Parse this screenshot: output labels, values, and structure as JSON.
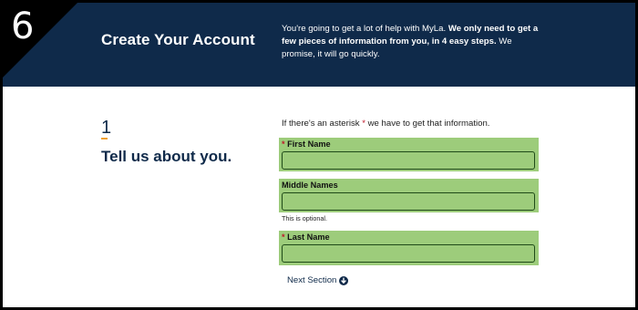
{
  "step_badge": "6",
  "header": {
    "title": "Create Your Account",
    "desc_part1": "You're going to get a lot of help with MyLa. ",
    "desc_bold": "We only need to get a few pieces of information from you, in 4 easy steps.",
    "desc_part2": " We promise, it will go quickly."
  },
  "section": {
    "number": "1",
    "title": "Tell us about you."
  },
  "note": {
    "before": "If there's an asterisk ",
    "asterisk": "*",
    "after": " we have to get that information."
  },
  "fields": {
    "first_name": {
      "required_mark": "*",
      "label": "First Name",
      "value": ""
    },
    "middle_names": {
      "label": "Middle Names",
      "value": "",
      "hint": "This is optional."
    },
    "last_name": {
      "required_mark": "*",
      "label": "Last Name",
      "value": ""
    }
  },
  "next_section": {
    "label": "Next Section",
    "icon": "arrow-down-circle-icon"
  },
  "colors": {
    "header_bg": "#0f2a4a",
    "highlight": "#9dcc7b",
    "accent_underline": "#f0a030",
    "required": "#c0182b"
  }
}
